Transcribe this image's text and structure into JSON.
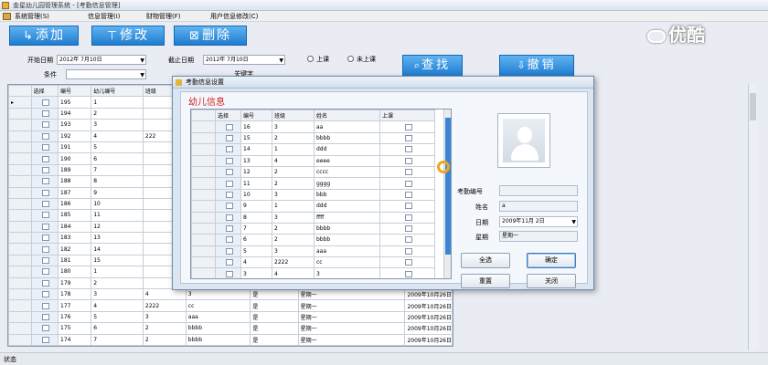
{
  "window": {
    "title": "金星幼儿园管理系统 - [考勤信息管理]"
  },
  "watermark": {
    "text": "优酷"
  },
  "menu": {
    "items": [
      "系统管理(S)",
      "信息管理(I)",
      "财物管理(F)",
      "用户信息修改(C)"
    ]
  },
  "toolbar": {
    "add": "添加",
    "edit": "修改",
    "delete": "删除"
  },
  "filters": {
    "start_label": "开始日期",
    "start_value": "2012年 7月10日",
    "end_label": "截止日期",
    "end_value": "2012年 7月10日",
    "cond_label": "条件",
    "cond_value": "",
    "keyword_label": "关键字",
    "radio_in": "上课",
    "radio_out": "未上课"
  },
  "buttons": {
    "search": "查找",
    "cancel": "撤销"
  },
  "grid": {
    "headers": [
      "选择",
      "编号",
      "幼儿编号",
      "班级",
      "",
      "",
      ""
    ],
    "rows": [
      [
        "195",
        "1",
        "",
        "",
        "",
        "",
        ""
      ],
      [
        "194",
        "2",
        "",
        "",
        "",
        "",
        ""
      ],
      [
        "193",
        "3",
        "",
        "",
        "",
        "",
        ""
      ],
      [
        "192",
        "4",
        "222",
        "",
        "",
        "",
        ""
      ],
      [
        "191",
        "5",
        "",
        "",
        "",
        "",
        ""
      ],
      [
        "190",
        "6",
        "",
        "",
        "",
        "",
        ""
      ],
      [
        "189",
        "7",
        "",
        "",
        "",
        "",
        ""
      ],
      [
        "188",
        "8",
        "",
        "",
        "",
        "",
        ""
      ],
      [
        "187",
        "9",
        "",
        "",
        "",
        "",
        ""
      ],
      [
        "186",
        "10",
        "",
        "",
        "",
        "",
        ""
      ],
      [
        "185",
        "11",
        "",
        "",
        "",
        "",
        ""
      ],
      [
        "184",
        "12",
        "",
        "",
        "",
        "",
        ""
      ],
      [
        "183",
        "13",
        "",
        "",
        "",
        "",
        ""
      ],
      [
        "182",
        "14",
        "",
        "",
        "",
        "",
        ""
      ],
      [
        "181",
        "15",
        "",
        "",
        "",
        "",
        ""
      ],
      [
        "180",
        "1",
        "",
        "",
        "",
        "",
        ""
      ],
      [
        "179",
        "2",
        "",
        "",
        "",
        "",
        ""
      ],
      [
        "178",
        "3",
        "4",
        "3",
        "是",
        "星期一",
        "2009年10月26日"
      ],
      [
        "177",
        "4",
        "2222",
        "cc",
        "是",
        "星期一",
        "2009年10月26日"
      ],
      [
        "176",
        "5",
        "3",
        "aaa",
        "是",
        "星期一",
        "2009年10月26日"
      ],
      [
        "175",
        "6",
        "2",
        "bbbb",
        "是",
        "星期一",
        "2009年10月26日"
      ],
      [
        "174",
        "7",
        "2",
        "bbbb",
        "是",
        "星期一",
        "2009年10月26日"
      ]
    ]
  },
  "status": {
    "text": "状态"
  },
  "dialog": {
    "title": "考勤信息设置",
    "heading": "幼儿信息",
    "grid_headers": [
      "选择",
      "编号",
      "班级",
      "姓名",
      "上课"
    ],
    "grid_rows": [
      [
        "16",
        "3",
        "aa"
      ],
      [
        "15",
        "2",
        "bbbb"
      ],
      [
        "14",
        "1",
        "ddd"
      ],
      [
        "13",
        "4",
        "eeee"
      ],
      [
        "12",
        "2",
        "cccc"
      ],
      [
        "11",
        "2",
        "gggg"
      ],
      [
        "10",
        "3",
        "bbb"
      ],
      [
        "9",
        "1",
        "ddd"
      ],
      [
        "8",
        "3",
        "ffff"
      ],
      [
        "7",
        "2",
        "bbbb"
      ],
      [
        "6",
        "2",
        "bbbb"
      ],
      [
        "5",
        "3",
        "aaa"
      ],
      [
        "4",
        "2222",
        "cc"
      ],
      [
        "3",
        "4",
        "3"
      ]
    ],
    "attendance_id_label": "考勤编号",
    "attendance_id_value": "",
    "name_label": "姓名",
    "name_value": "a",
    "date_label": "日期",
    "date_value": "2009年11月 2日",
    "week_label": "星期",
    "week_value": "星期一",
    "btn_select_all": "全选",
    "btn_ok": "确定",
    "btn_reset": "重置",
    "btn_close": "关闭"
  }
}
